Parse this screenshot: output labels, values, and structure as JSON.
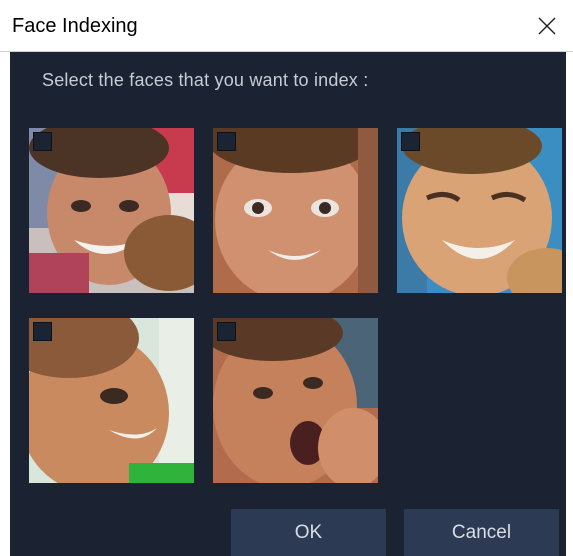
{
  "window": {
    "title": "Face Indexing",
    "close_icon": "close-icon"
  },
  "dialog": {
    "prompt": "Select the faces that you want to index :"
  },
  "faces": [
    {
      "checked": false,
      "icon": "face-thumbnail"
    },
    {
      "checked": false,
      "icon": "face-thumbnail"
    },
    {
      "checked": false,
      "icon": "face-thumbnail"
    },
    {
      "checked": false,
      "icon": "face-thumbnail"
    },
    {
      "checked": false,
      "icon": "face-thumbnail"
    }
  ],
  "buttons": {
    "ok_label": "OK",
    "cancel_label": "Cancel"
  },
  "colors": {
    "background": "#1b2231",
    "button": "#2c3a53",
    "prompt_text": "#c7ccd6"
  }
}
